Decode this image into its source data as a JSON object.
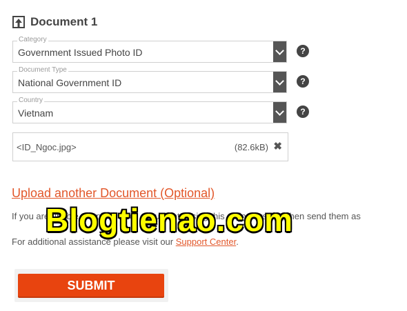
{
  "document": {
    "title": "Document 1",
    "icon": "upload-icon"
  },
  "fields": [
    {
      "label": "Category",
      "value": "Government Issued Photo ID"
    },
    {
      "label": "Document Type",
      "value": "National Government ID"
    },
    {
      "label": "Country",
      "value": "Vietnam"
    }
  ],
  "help_icon_text": "?",
  "file": {
    "name": "<ID_Ngoc.jpg>",
    "size": "(82.6kB)",
    "remove_symbol": "✖"
  },
  "upload_another_label": "Upload another Document (Optional)",
  "info_text": "If you are unable to upload your documents using this online system, then send them as",
  "assistance": {
    "prefix": "For additional assistance please visit our ",
    "link_label": "Support Center",
    "suffix": "."
  },
  "watermark": "Blogtienao.com",
  "submit_label": "SUBMIT",
  "colors": {
    "accent": "#e2572a",
    "button": "#e8440f",
    "dropdown": "#555555",
    "watermark": "#ffff00"
  }
}
